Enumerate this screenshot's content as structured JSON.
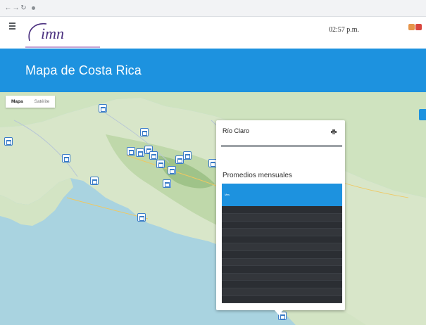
{
  "browser": {
    "back_glyph": "←",
    "forward_glyph": "→",
    "reload_glyph": "↻",
    "url": ""
  },
  "header": {
    "menu_label": "",
    "logo_text": "imn",
    "time": "02:57 p.m.",
    "date": "",
    "right_label": ""
  },
  "page": {
    "title": "Mapa de Costa Rica"
  },
  "map": {
    "toggle": {
      "map_label": "Mapa",
      "satellite_label": "Satélite"
    },
    "place_labels": []
  },
  "station": {
    "name": "Río Claro",
    "subtitle": "",
    "description": ""
  },
  "monthly": {
    "title": "Promedios mensuales",
    "columns": [
      "Mes",
      "",
      "",
      "",
      "",
      "",
      "",
      ""
    ],
    "header_group": "",
    "rows": []
  },
  "colors": {
    "brand_blue": "#1d92df",
    "table_dark": "#2b2e33",
    "marker_blue": "#3a7cc8"
  }
}
